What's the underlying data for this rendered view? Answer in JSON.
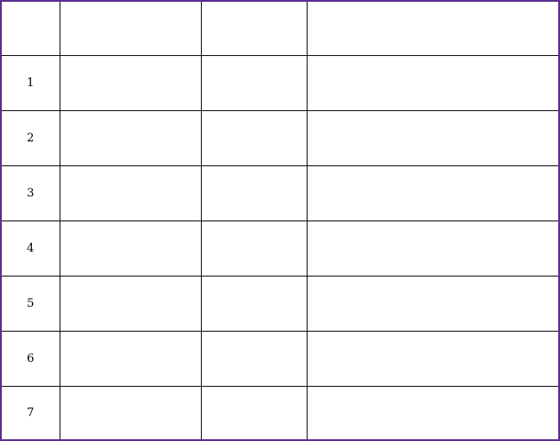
{
  "table": {
    "headers": {
      "no": "",
      "name": "",
      "status": "",
      "remark": ""
    },
    "rows": [
      {
        "no": "1",
        "name": "",
        "status": "",
        "remark": ""
      },
      {
        "no": "2",
        "name": "",
        "status": "",
        "remark": ""
      },
      {
        "no": "3",
        "name": "",
        "status": "",
        "remark": ""
      },
      {
        "no": "4",
        "name": "",
        "status": "",
        "remark": ""
      },
      {
        "no": "5",
        "name": "",
        "status": "",
        "remark": ""
      },
      {
        "no": "6",
        "name": "",
        "status": "",
        "remark": ""
      },
      {
        "no": "7",
        "name": "",
        "status": "",
        "remark": ""
      }
    ]
  },
  "colors": {
    "frame": "#5b2d8f",
    "grid": "#111111",
    "background": "#ffffff"
  }
}
